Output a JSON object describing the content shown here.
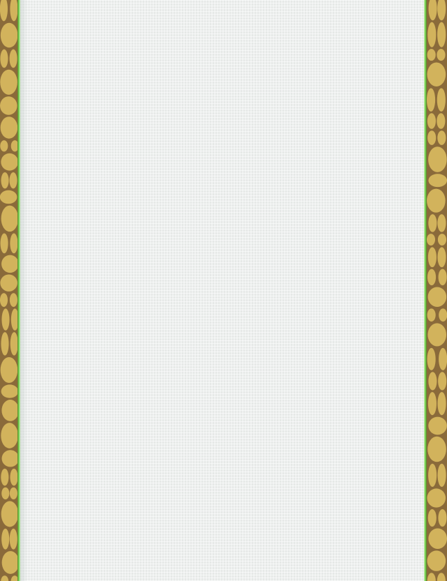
{
  "page": {
    "background_color": "#eef0ef",
    "border_pattern_color": "#d2b35c",
    "border_crack_color": "#8a6a3a",
    "edge_glow_color": "#6fcf4a"
  },
  "decor": {
    "left_border_icon": "stone-pattern",
    "right_border_icon": "stone-pattern"
  }
}
